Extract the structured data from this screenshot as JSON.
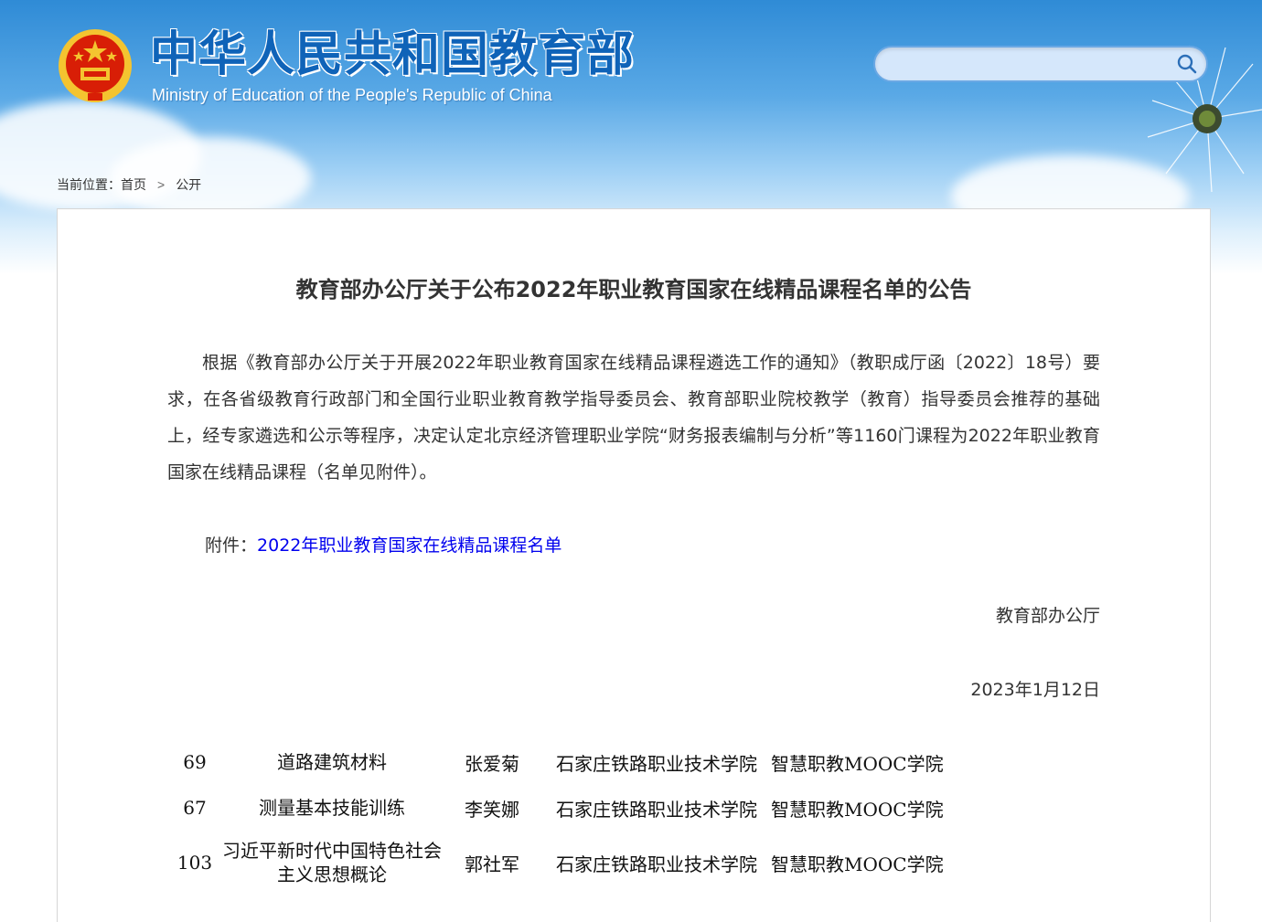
{
  "header": {
    "site_title": "中华人民共和国教育部",
    "site_subtitle": "Ministry of Education of the People's Republic of China",
    "emblem_icon": "national-emblem-icon",
    "search": {
      "placeholder": "",
      "icon": "search-icon"
    }
  },
  "breadcrumb": {
    "label": "当前位置：",
    "items": [
      "首页",
      "公开"
    ],
    "separator": ">"
  },
  "article": {
    "title": "教育部办公厅关于公布2022年职业教育国家在线精品课程名单的公告",
    "body": "根据《教育部办公厅关于开展2022年职业教育国家在线精品课程遴选工作的通知》（教职成厅函〔2022〕18号）要求，在各省级教育行政部门和全国行业职业教育教学指导委员会、教育部职业院校教学（教育）指导委员会推荐的基础上，经专家遴选和公示等程序，决定认定北京经济管理职业学院“财务报表编制与分析”等1160门课程为2022年职业教育国家在线精品课程（名单见附件）。",
    "attachment_label": "附件：",
    "attachment_link": "2022年职业教育国家在线精品课程名单",
    "signer": "教育部办公厅",
    "date": "2023年1月12日"
  },
  "course_rows": [
    {
      "num": "69",
      "name": "道路建筑材料",
      "person": "张爱菊",
      "school": "石家庄铁路职业技术学院",
      "platform": "智慧职教MOOC学院"
    },
    {
      "num": "67",
      "name": "测量基本技能训练",
      "person": "李笑娜",
      "school": "石家庄铁路职业技术学院",
      "platform": "智慧职教MOOC学院"
    },
    {
      "num": "103",
      "name": "习近平新时代中国特色社会主义思想概论",
      "person": "郭社军",
      "school": "石家庄铁路职业技术学院",
      "platform": "智慧职教MOOC学院"
    }
  ],
  "colors": {
    "title_blue": "#0f63b8",
    "link_blue": "#0000ee",
    "text": "#333333",
    "emblem_red": "#d81e06",
    "emblem_gold": "#f4c430"
  }
}
